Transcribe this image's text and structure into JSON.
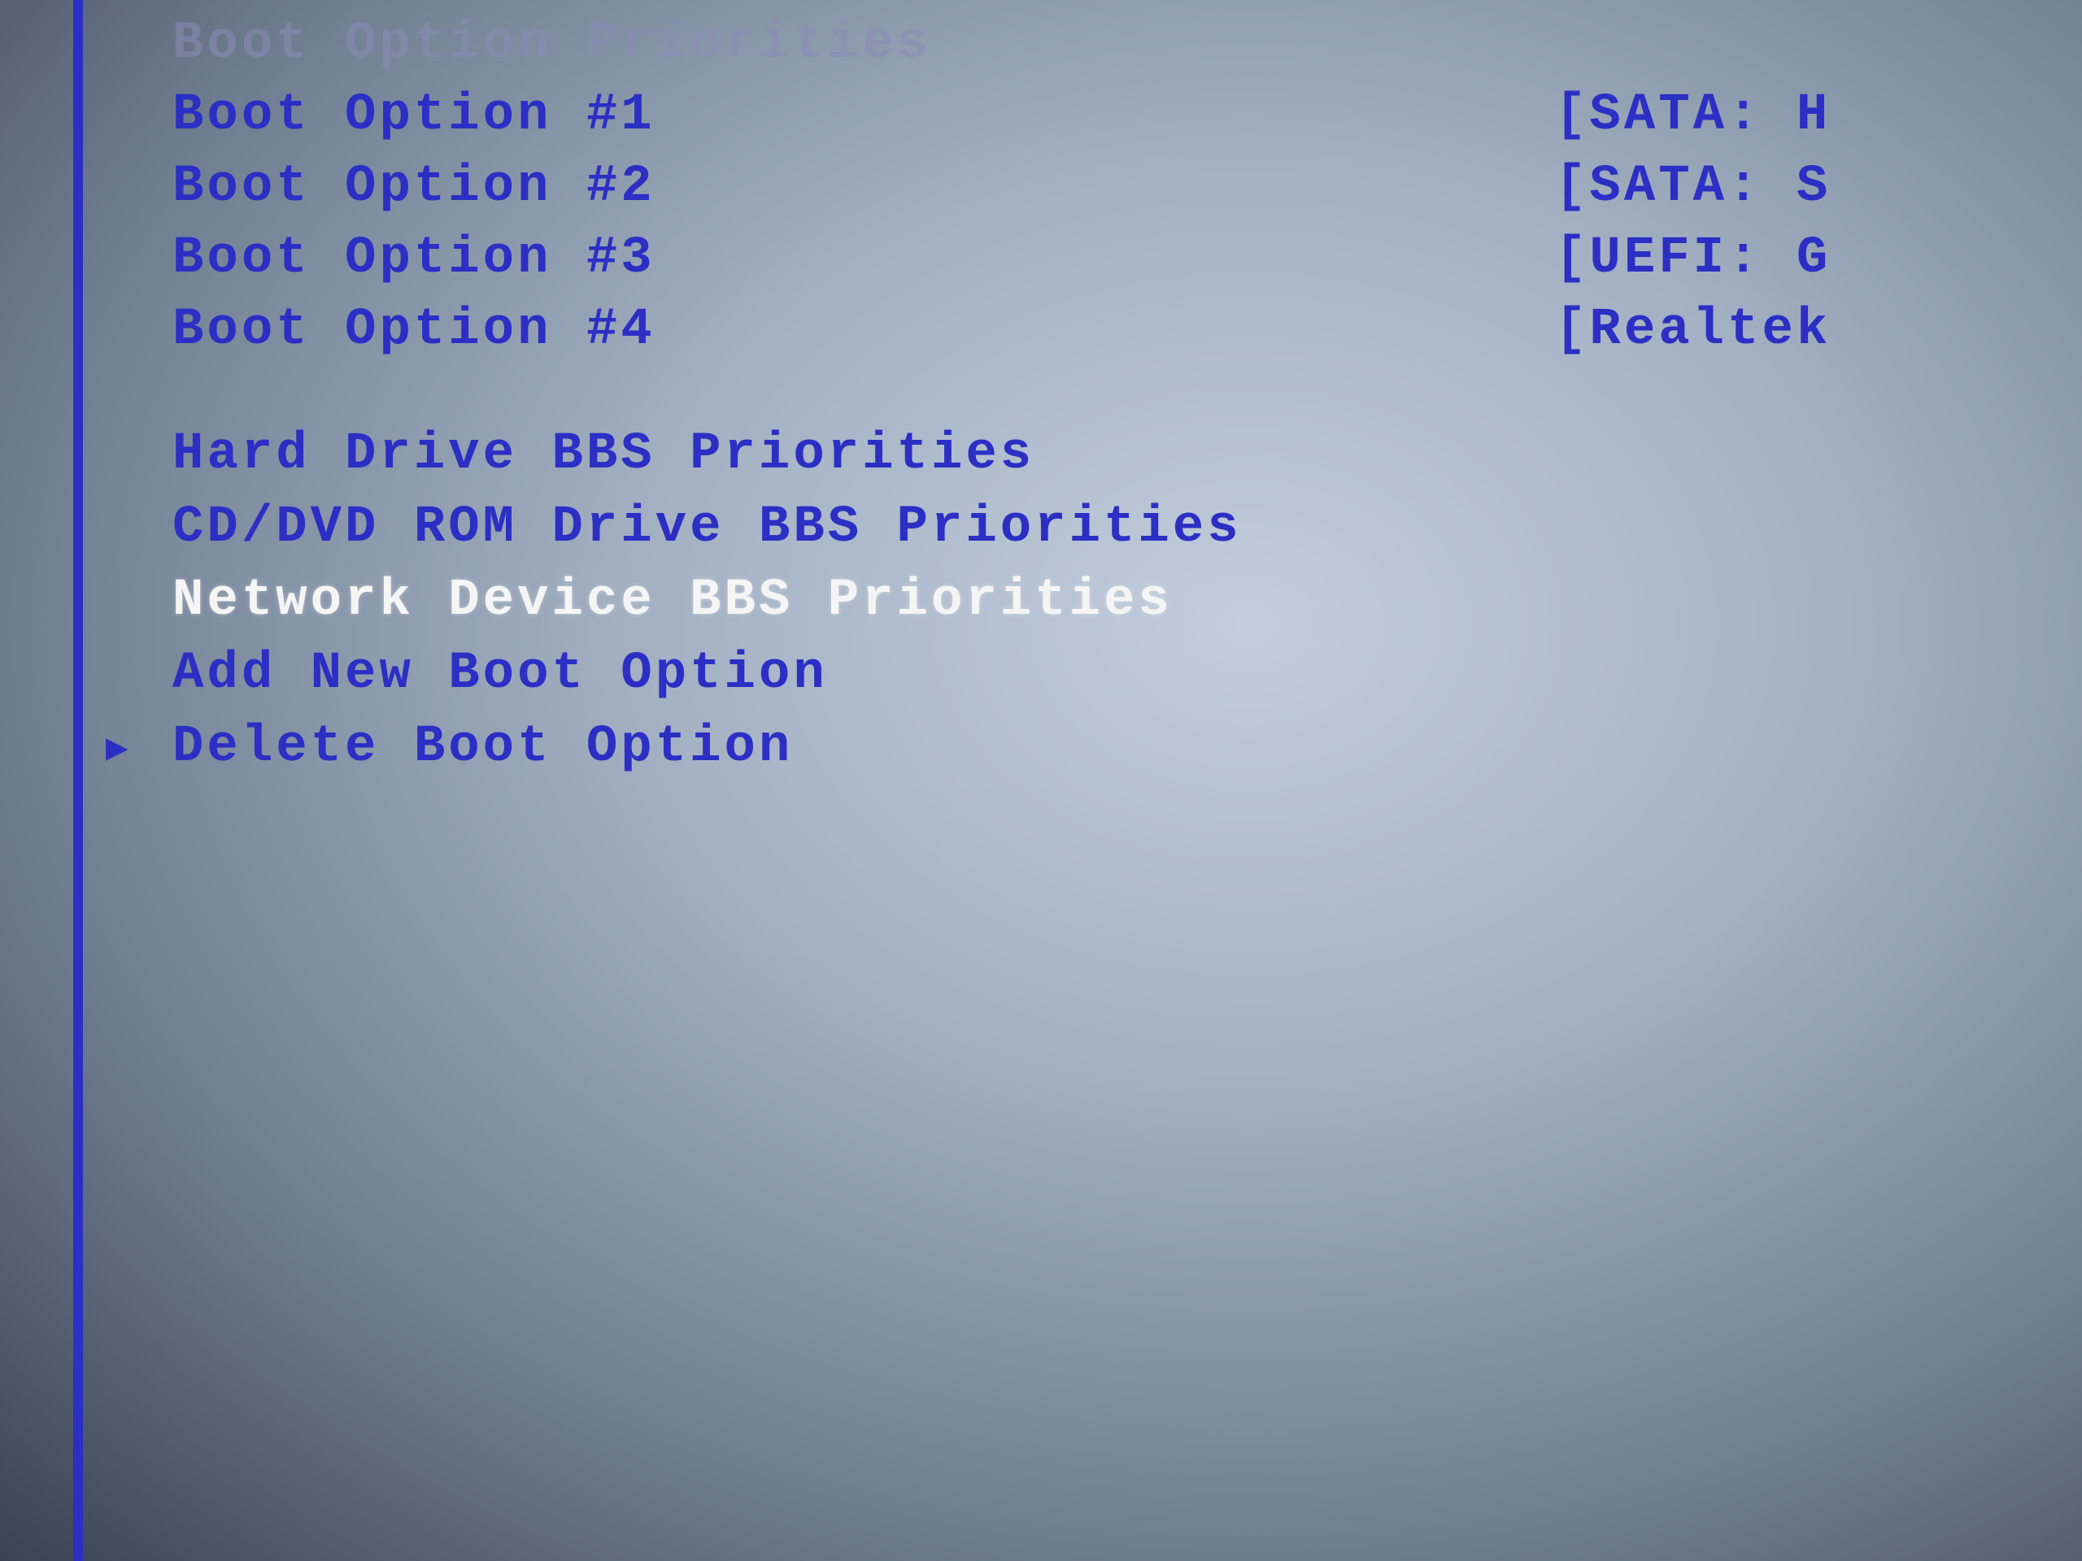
{
  "sectionHeader": "Boot Option Priorities",
  "bootOptions": [
    {
      "label": "Boot Option #1",
      "value": "[SATA: H"
    },
    {
      "label": "Boot Option #2",
      "value": "[SATA: S"
    },
    {
      "label": "Boot Option #3",
      "value": "[UEFI: G"
    },
    {
      "label": "Boot Option #4",
      "value": "[Realtek"
    }
  ],
  "menu": [
    {
      "label": "Hard Drive BBS Priorities",
      "selected": false,
      "cursor": false
    },
    {
      "label": "CD/DVD ROM Drive BBS Priorities",
      "selected": false,
      "cursor": false
    },
    {
      "label": "Network Device BBS Priorities",
      "selected": true,
      "cursor": false
    },
    {
      "label": "Add New Boot Option",
      "selected": false,
      "cursor": false
    },
    {
      "label": "Delete Boot Option",
      "selected": false,
      "cursor": true
    }
  ],
  "cursorGlyph": "▶"
}
